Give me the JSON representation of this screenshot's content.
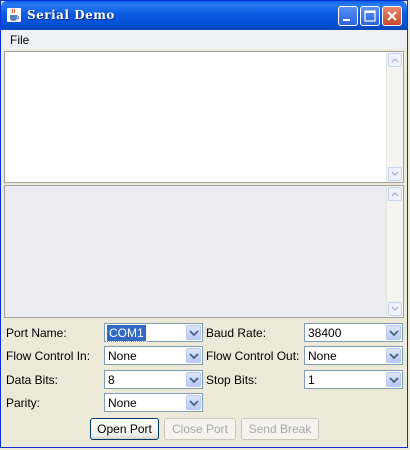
{
  "window": {
    "title": "Serial Demo"
  },
  "menu": {
    "file": "File"
  },
  "fields": {
    "port_name": {
      "label": "Port Name:",
      "value": "COM1"
    },
    "baud_rate": {
      "label": "Baud Rate:",
      "value": "38400"
    },
    "flow_control_in": {
      "label": "Flow Control In:",
      "value": "None"
    },
    "flow_control_out": {
      "label": "Flow Control Out:",
      "value": "None"
    },
    "data_bits": {
      "label": "Data Bits:",
      "value": "8"
    },
    "stop_bits": {
      "label": "Stop Bits:",
      "value": "1"
    },
    "parity": {
      "label": "Parity:",
      "value": "None"
    }
  },
  "buttons": {
    "open_port": "Open Port",
    "close_port": "Close Port",
    "send_break": "Send Break"
  },
  "colors": {
    "titlebar": "#0a5bdf",
    "selection": "#316ac5",
    "disabled_text": "#a7a6aa"
  }
}
